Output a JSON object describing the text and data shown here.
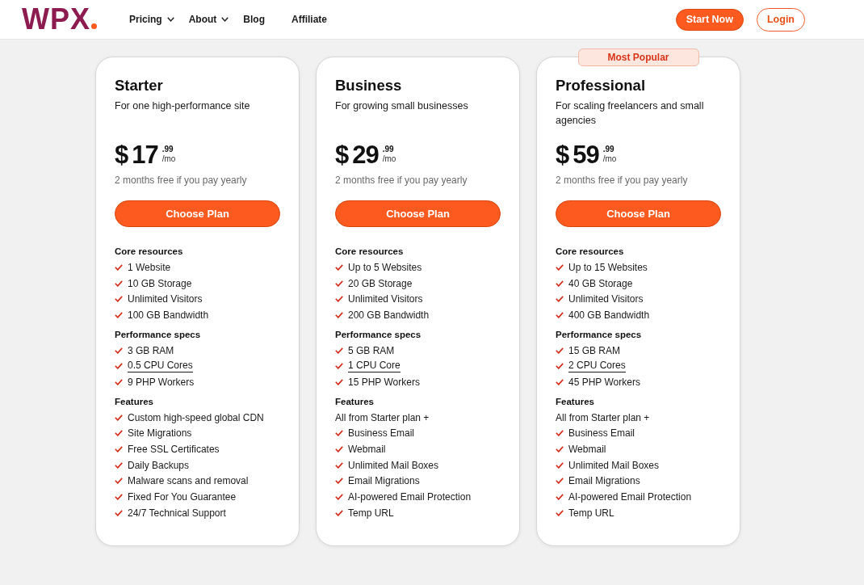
{
  "header": {
    "logo": "WPX",
    "nav": [
      {
        "label": "Pricing",
        "dropdown": true
      },
      {
        "label": "About",
        "dropdown": true
      },
      {
        "label": "Blog",
        "dropdown": false
      },
      {
        "label": "Affiliate",
        "dropdown": false
      }
    ],
    "actions": [
      {
        "label": "Start Now",
        "kind": "primary"
      },
      {
        "label": "Login",
        "kind": "outline"
      }
    ]
  },
  "plans": [
    {
      "name": "Starter",
      "tagline": "For one high-performance site",
      "price": {
        "currency": "$",
        "amount": "17",
        "cents": ".99",
        "period": "/mo"
      },
      "note": "2 months free if you pay yearly",
      "button": "Choose Plan",
      "sections": [
        {
          "title": "Core resources",
          "items": [
            {
              "kind": "check",
              "text": "1 Website"
            },
            {
              "kind": "check",
              "text": "10 GB Storage"
            },
            {
              "kind": "check",
              "text": "Unlimited Visitors"
            },
            {
              "kind": "check",
              "text": "100 GB Bandwidth"
            }
          ]
        },
        {
          "title": "Performance specs",
          "items": [
            {
              "kind": "check",
              "text": "3 GB RAM"
            },
            {
              "kind": "link",
              "text": "0.5 CPU Cores"
            },
            {
              "kind": "check",
              "text": "9 PHP Workers"
            }
          ]
        },
        {
          "title": "Features",
          "items": [
            {
              "kind": "check",
              "text": "Custom high-speed global CDN"
            },
            {
              "kind": "check",
              "text": "Site Migrations"
            },
            {
              "kind": "check",
              "text": "Free SSL Certificates"
            },
            {
              "kind": "check",
              "text": "Daily Backups"
            },
            {
              "kind": "check",
              "text": "Malware scans and removal"
            },
            {
              "kind": "check",
              "text": "Fixed For You Guarantee"
            },
            {
              "kind": "check",
              "text": "24/7 Technical Support"
            }
          ]
        }
      ]
    },
    {
      "name": "Business",
      "tagline": "For growing small businesses",
      "price": {
        "currency": "$",
        "amount": "29",
        "cents": ".99",
        "period": "/mo"
      },
      "note": "2 months free if you pay yearly",
      "button": "Choose Plan",
      "sections": [
        {
          "title": "Core resources",
          "items": [
            {
              "kind": "check",
              "text": "Up to 5 Websites"
            },
            {
              "kind": "check",
              "text": "20 GB Storage"
            },
            {
              "kind": "check",
              "text": "Unlimited Visitors"
            },
            {
              "kind": "check",
              "text": "200 GB Bandwidth"
            }
          ]
        },
        {
          "title": "Performance specs",
          "items": [
            {
              "kind": "check",
              "text": "5 GB RAM"
            },
            {
              "kind": "link",
              "text": "1 CPU Core"
            },
            {
              "kind": "check",
              "text": "15 PHP Workers"
            }
          ]
        },
        {
          "title": "Features",
          "items": [
            {
              "kind": "plain",
              "text": "All from Starter plan +"
            },
            {
              "kind": "check",
              "text": "Business Email"
            },
            {
              "kind": "check",
              "text": "Webmail"
            },
            {
              "kind": "check",
              "text": "Unlimited Mail Boxes"
            },
            {
              "kind": "check",
              "text": "Email Migrations"
            },
            {
              "kind": "check",
              "text": "AI-powered Email Protection"
            },
            {
              "kind": "check",
              "text": "Temp URL"
            }
          ]
        }
      ]
    },
    {
      "name": "Professional",
      "badge": "Most Popular",
      "tagline": "For scaling freelancers and small agencies",
      "price": {
        "currency": "$",
        "amount": "59",
        "cents": ".99",
        "period": "/mo"
      },
      "note": "2 months free if you pay yearly",
      "button": "Choose Plan",
      "sections": [
        {
          "title": "Core resources",
          "items": [
            {
              "kind": "check",
              "text": "Up to 15 Websites"
            },
            {
              "kind": "check",
              "text": "40 GB Storage"
            },
            {
              "kind": "check",
              "text": "Unlimited Visitors"
            },
            {
              "kind": "check",
              "text": "400 GB Bandwidth"
            }
          ]
        },
        {
          "title": "Performance specs",
          "items": [
            {
              "kind": "check",
              "text": "15 GB RAM"
            },
            {
              "kind": "link",
              "text": "2 CPU Cores"
            },
            {
              "kind": "check",
              "text": "45 PHP Workers"
            }
          ]
        },
        {
          "title": "Features",
          "items": [
            {
              "kind": "plain",
              "text": "All from Starter plan +"
            },
            {
              "kind": "check",
              "text": "Business Email"
            },
            {
              "kind": "check",
              "text": "Webmail"
            },
            {
              "kind": "check",
              "text": "Unlimited Mail Boxes"
            },
            {
              "kind": "check",
              "text": "Email Migrations"
            },
            {
              "kind": "check",
              "text": "AI-powered Email Protection"
            },
            {
              "kind": "check",
              "text": "Temp URL"
            }
          ]
        }
      ]
    }
  ]
}
